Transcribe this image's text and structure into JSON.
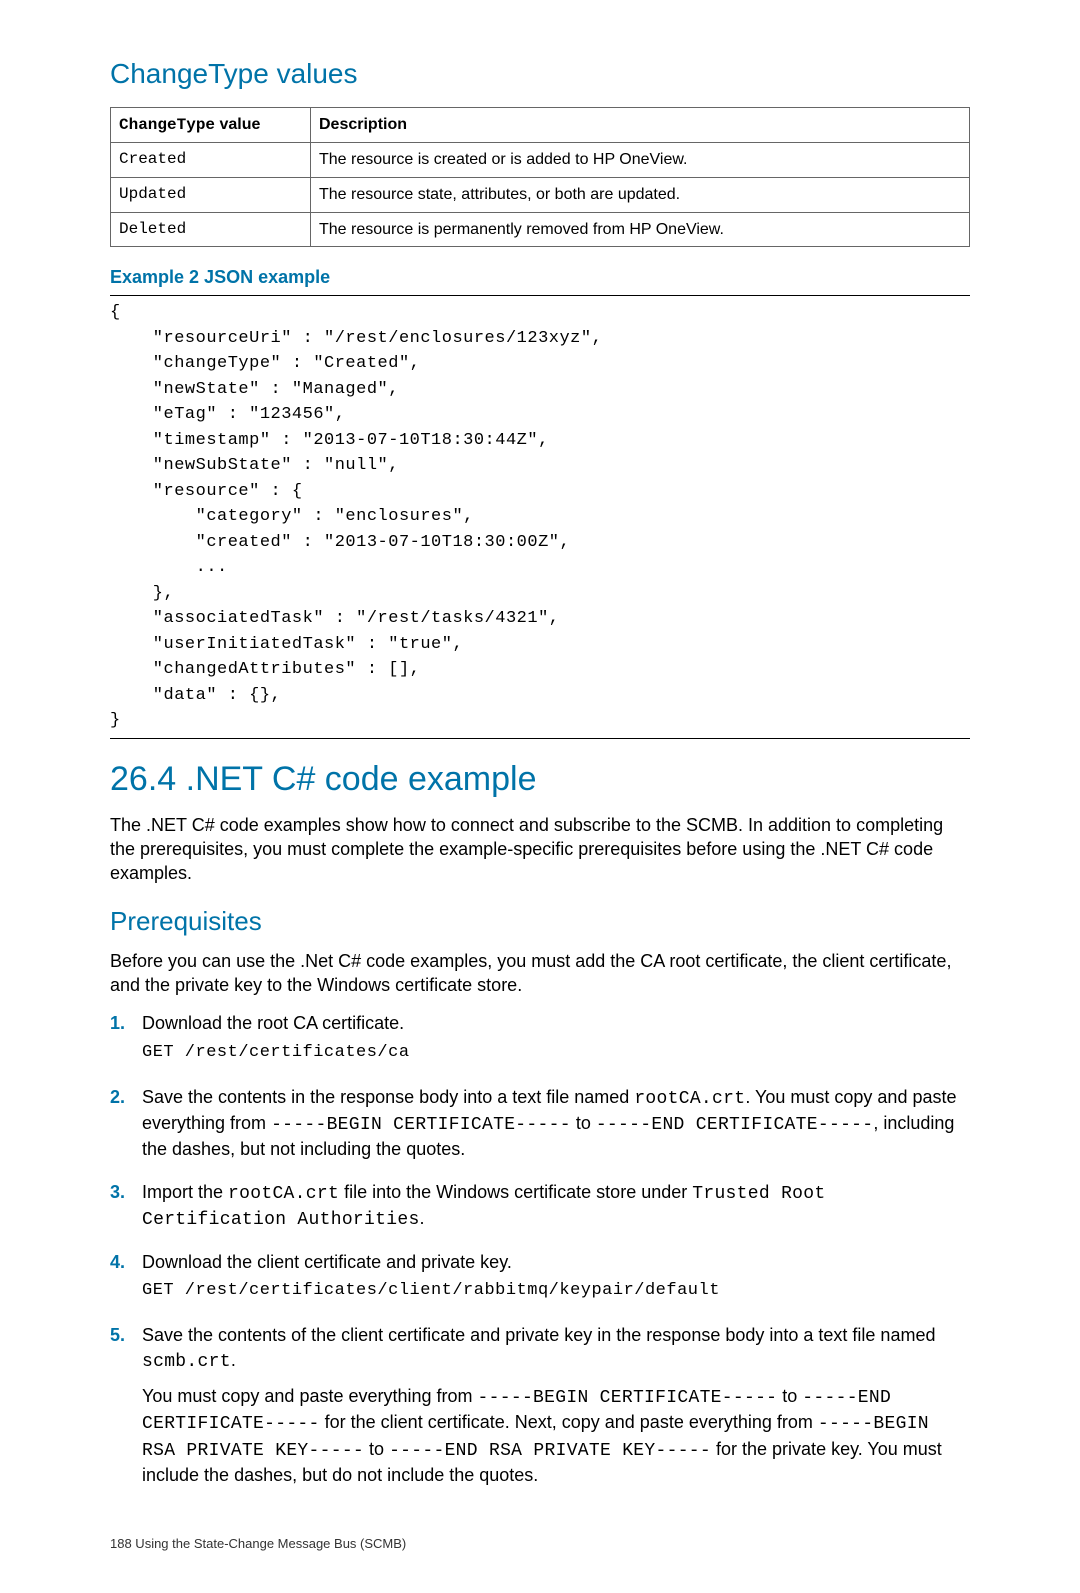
{
  "heading_changetype": "ChangeType values",
  "table": {
    "header": {
      "col1_prefix": "ChangeType",
      "col1_suffix": " value",
      "col2": "Description"
    },
    "rows": [
      {
        "val": "Created",
        "desc": "The resource is created or is added to HP OneView."
      },
      {
        "val": "Updated",
        "desc": "The resource state, attributes, or both are updated."
      },
      {
        "val": "Deleted",
        "desc": "The resource is permanently removed from HP OneView."
      }
    ]
  },
  "example_title": "Example 2 JSON example",
  "json_example": "{\n    \"resourceUri\" : \"/rest/enclosures/123xyz\",\n    \"changeType\" : \"Created\",\n    \"newState\" : \"Managed\",\n    \"eTag\" : \"123456\",\n    \"timestamp\" : \"2013-07-10T18:30:44Z\",\n    \"newSubState\" : \"null\",\n    \"resource\" : {\n        \"category\" : \"enclosures\",\n        \"created\" : \"2013-07-10T18:30:00Z\",\n        ...\n    },\n    \"associatedTask\" : \"/rest/tasks/4321\",\n    \"userInitiatedTask\" : \"true\",\n    \"changedAttributes\" : [],\n    \"data\" : {},\n}",
  "section_heading": "26.4 .NET C# code example",
  "section_intro": "The .NET C# code examples show how to connect and subscribe to the SCMB. In addition to completing the prerequisites, you must complete the example-specific prerequisites before using the .NET C# code examples.",
  "prereq_heading": "Prerequisites",
  "prereq_intro": "Before you can use the .Net C# code examples, you must add the CA root certificate, the client certificate, and the private key to the Windows certificate store.",
  "steps": {
    "s1": {
      "num": "1.",
      "text": "Download the root CA certificate.",
      "code": "GET /rest/certificates/ca"
    },
    "s2": {
      "num": "2.",
      "pre": "Save the contents in the response body into a text file named ",
      "f1": "rootCA.crt",
      "mid1": ". You must copy and paste everything from ",
      "c1": "-----BEGIN CERTIFICATE-----",
      "mid2": " to ",
      "c2": "-----END CERTIFICATE-----",
      "post": ", including the dashes, but not including the quotes."
    },
    "s3": {
      "num": "3.",
      "pre": "Import the ",
      "f1": "rootCA.crt",
      "mid1": " file into the Windows certificate store under ",
      "c1": "Trusted Root Certification Authorities",
      "post": "."
    },
    "s4": {
      "num": "4.",
      "text": "Download the client certificate and private key.",
      "code": "GET /rest/certificates/client/rabbitmq/keypair/default"
    },
    "s5": {
      "num": "5.",
      "p1_pre": "Save the contents of the client certificate and private key in the response body into a text file named ",
      "p1_f": "scmb.crt",
      "p1_post": ".",
      "p2_pre": "You must copy and paste everything from ",
      "p2_c1": "-----BEGIN CERTIFICATE-----",
      "p2_m1": " to ",
      "p2_c2": "-----END CERTIFICATE-----",
      "p2_m2": " for the client certificate. Next, copy and paste everything from ",
      "p2_c3": "-----BEGIN RSA PRIVATE KEY-----",
      "p2_m3": " to ",
      "p2_c4": "-----END RSA PRIVATE KEY-----",
      "p2_post": " for the private key. You must include the dashes, but do not include the quotes."
    }
  },
  "footer": "188   Using the State-Change Message Bus (SCMB)"
}
